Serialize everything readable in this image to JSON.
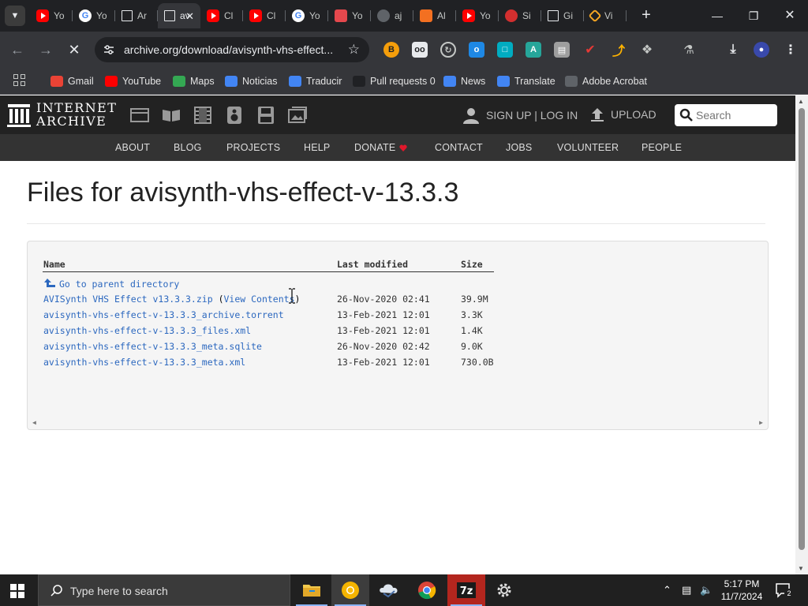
{
  "browser": {
    "tabs": [
      {
        "label": "Yo",
        "icon": "youtube-icon",
        "favclass": "yt"
      },
      {
        "label": "Yo",
        "icon": "google-icon",
        "favclass": "g"
      },
      {
        "label": "Ar",
        "icon": "internet-archive-icon",
        "favclass": "ia"
      },
      {
        "label": "av",
        "icon": "internet-archive-icon",
        "favclass": "ia",
        "active": true
      },
      {
        "label": "Cl",
        "icon": "youtube-icon",
        "favclass": "yt"
      },
      {
        "label": "Cl",
        "icon": "youtube-icon",
        "favclass": "yt"
      },
      {
        "label": "Yo",
        "icon": "google-icon",
        "favclass": "g"
      },
      {
        "label": "Yo",
        "icon": "download-icon",
        "favclass": "dl"
      },
      {
        "label": "aj",
        "icon": "globe-icon",
        "favclass": "globe"
      },
      {
        "label": "Al",
        "icon": "aliexpress-icon",
        "favclass": "ali"
      },
      {
        "label": "Yo",
        "icon": "youtube-icon",
        "favclass": "yt"
      },
      {
        "label": "Si",
        "icon": "red-circle-icon",
        "favclass": "rd"
      },
      {
        "label": "Gi",
        "icon": "internet-archive-icon",
        "favclass": "ia"
      },
      {
        "label": "Vi",
        "icon": "diamond-icon",
        "favclass": "v"
      }
    ],
    "url": "archive.org/download/avisynth-vhs-effect...",
    "bookmarks": [
      {
        "label": "Gmail",
        "icon": "gmail-icon",
        "color": "#ea4335"
      },
      {
        "label": "YouTube",
        "icon": "youtube-icon",
        "color": "#ff0000"
      },
      {
        "label": "Maps",
        "icon": "maps-icon",
        "color": "#34a853"
      },
      {
        "label": "Noticias",
        "icon": "google-news-icon",
        "color": "#4285f4"
      },
      {
        "label": "Traducir",
        "icon": "google-translate-icon",
        "color": "#4285f4"
      },
      {
        "label": "Pull requests 0",
        "icon": "github-icon",
        "color": "#202124"
      },
      {
        "label": "News",
        "icon": "google-news-icon",
        "color": "#4285f4"
      },
      {
        "label": "Translate",
        "icon": "google-translate-icon",
        "color": "#4285f4"
      },
      {
        "label": "Adobe Acrobat",
        "icon": "globe-icon",
        "color": "#5f6368"
      }
    ]
  },
  "ia": {
    "logo_line1": "INTERNET",
    "logo_line2": "ARCHIVE",
    "signup": "SIGN UP | LOG IN",
    "upload": "UPLOAD",
    "search_placeholder": "Search",
    "nav": [
      "ABOUT",
      "BLOG",
      "PROJECTS",
      "HELP",
      "DONATE",
      "CONTACT",
      "JOBS",
      "VOLUNTEER",
      "PEOPLE"
    ]
  },
  "page": {
    "title": "Files for avisynth-vhs-effect-v-13.3.3",
    "columns": {
      "name": "Name",
      "modified": "Last modified",
      "size": "Size"
    },
    "parent": "Go to parent directory",
    "files": [
      {
        "name": "AVISynth VHS Effect v13.3.3.zip",
        "extra": "View Contents",
        "modified": "26-Nov-2020 02:41",
        "size": "39.9M"
      },
      {
        "name": "avisynth-vhs-effect-v-13.3.3_archive.torrent",
        "modified": "13-Feb-2021 12:01",
        "size": "3.3K"
      },
      {
        "name": "avisynth-vhs-effect-v-13.3.3_files.xml",
        "modified": "13-Feb-2021 12:01",
        "size": "1.4K"
      },
      {
        "name": "avisynth-vhs-effect-v-13.3.3_meta.sqlite",
        "modified": "26-Nov-2020 02:42",
        "size": "9.0K"
      },
      {
        "name": "avisynth-vhs-effect-v-13.3.3_meta.xml",
        "modified": "13-Feb-2021 12:01",
        "size": "730.0B"
      }
    ]
  },
  "taskbar": {
    "search_placeholder": "Type here to search",
    "time": "5:17 PM",
    "date": "11/7/2024",
    "notifications": "2"
  }
}
